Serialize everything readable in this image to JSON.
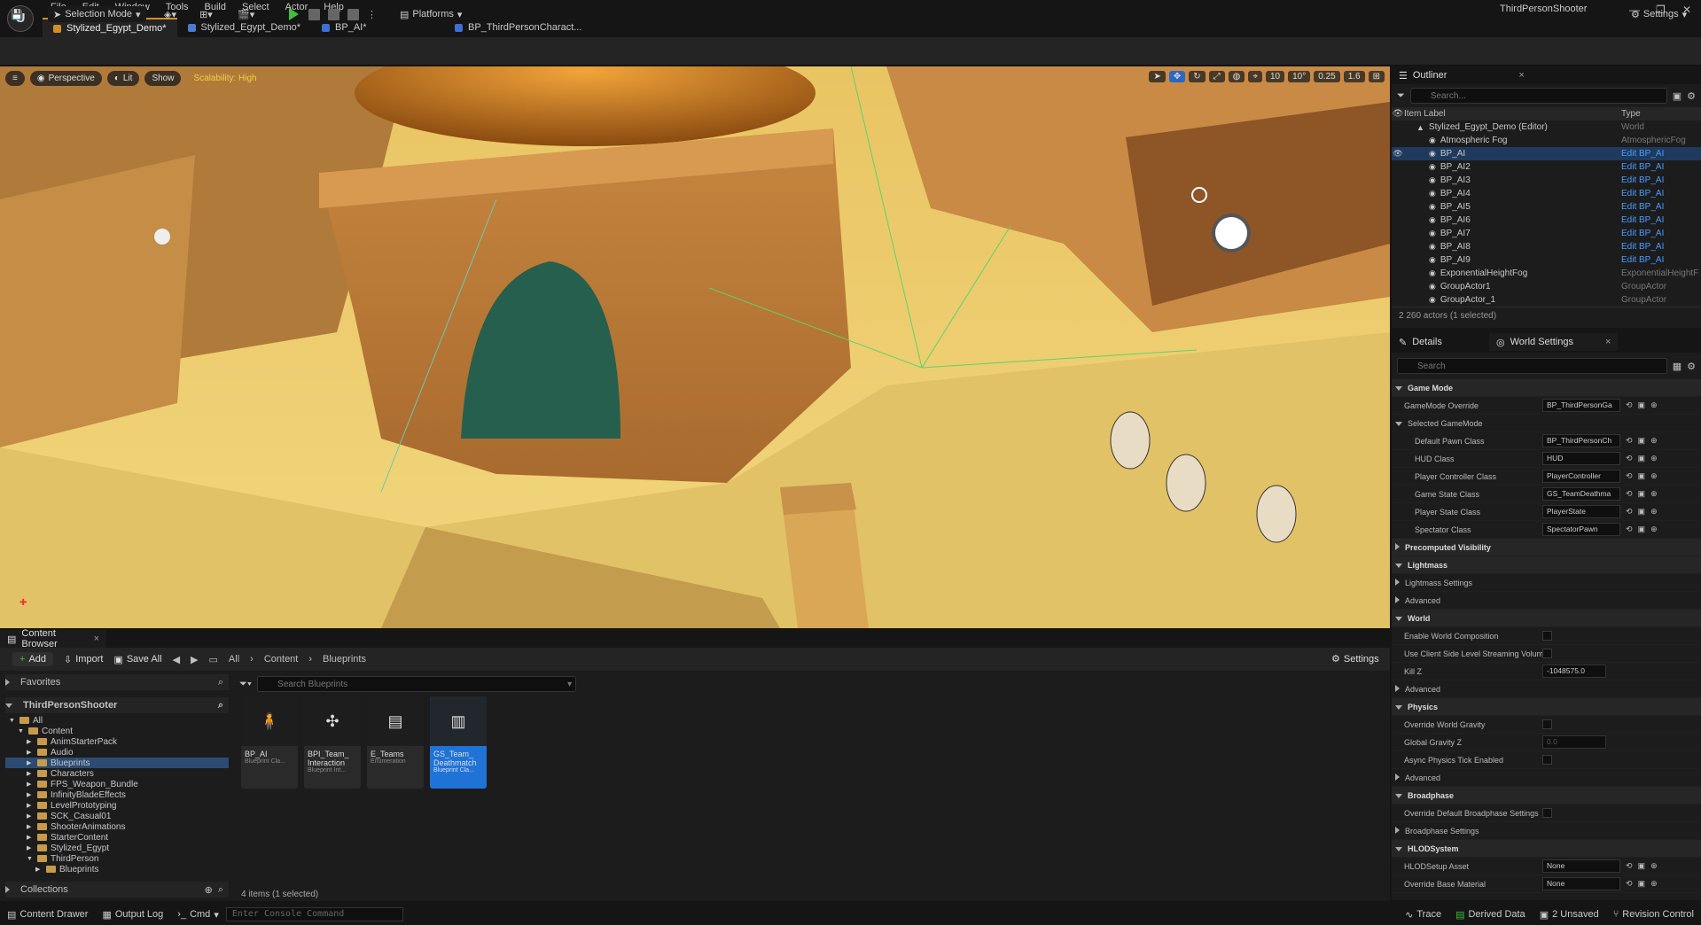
{
  "app": {
    "logo": "U",
    "menu": [
      "File",
      "Edit",
      "Window",
      "Tools",
      "Build",
      "Select",
      "Actor",
      "Help"
    ],
    "project_name": "ThirdPersonShooter",
    "tabs": [
      {
        "label": "Stylized_Egypt_Demo*",
        "icon": "level-icon",
        "active": true
      },
      {
        "label": "Stylized_Egypt_Demo*",
        "icon": "level-icon",
        "active": false
      },
      {
        "label": "BP_AI*",
        "icon": "blueprint-icon",
        "active": false
      },
      {
        "label": "BP_ThirdPersonCharact...",
        "icon": "blueprint-icon",
        "active": false
      }
    ]
  },
  "toolbar": {
    "selection_mode": "Selection Mode",
    "platforms": "Platforms",
    "settings": "Settings"
  },
  "viewport": {
    "perspective": "Perspective",
    "lit": "Lit",
    "show": "Show",
    "scalability": "Scalability: High",
    "grid_snap": "10",
    "rotation_snap": "10°",
    "scale_snap": "0.25",
    "camera_speed": "1.6"
  },
  "outliner": {
    "title": "Outliner",
    "search_placeholder": "Search...",
    "col_label": "Item Label",
    "col_type": "Type",
    "rows": [
      {
        "label": "Stylized_Egypt_Demo (Editor)",
        "type": "World",
        "indent": 1,
        "selected": false,
        "link": false
      },
      {
        "label": "Atmospheric Fog",
        "type": "AtmosphericFog",
        "indent": 2,
        "selected": false,
        "link": false
      },
      {
        "label": "BP_AI",
        "type": "Edit BP_AI",
        "indent": 2,
        "selected": true,
        "link": true
      },
      {
        "label": "BP_AI2",
        "type": "Edit BP_AI",
        "indent": 2,
        "selected": false,
        "link": true
      },
      {
        "label": "BP_AI3",
        "type": "Edit BP_AI",
        "indent": 2,
        "selected": false,
        "link": true
      },
      {
        "label": "BP_AI4",
        "type": "Edit BP_AI",
        "indent": 2,
        "selected": false,
        "link": true
      },
      {
        "label": "BP_AI5",
        "type": "Edit BP_AI",
        "indent": 2,
        "selected": false,
        "link": true
      },
      {
        "label": "BP_AI6",
        "type": "Edit BP_AI",
        "indent": 2,
        "selected": false,
        "link": true
      },
      {
        "label": "BP_AI7",
        "type": "Edit BP_AI",
        "indent": 2,
        "selected": false,
        "link": true
      },
      {
        "label": "BP_AI8",
        "type": "Edit BP_AI",
        "indent": 2,
        "selected": false,
        "link": true
      },
      {
        "label": "BP_AI9",
        "type": "Edit BP_AI",
        "indent": 2,
        "selected": false,
        "link": true
      },
      {
        "label": "ExponentialHeightFog",
        "type": "ExponentialHeightF",
        "indent": 2,
        "selected": false,
        "link": false
      },
      {
        "label": "GroupActor1",
        "type": "GroupActor",
        "indent": 2,
        "selected": false,
        "link": false
      },
      {
        "label": "GroupActor_1",
        "type": "GroupActor",
        "indent": 2,
        "selected": false,
        "link": false
      }
    ],
    "footer": "2 260 actors (1 selected)"
  },
  "details": {
    "tab_details": "Details",
    "tab_world_settings": "World Settings",
    "search_placeholder": "Search",
    "rows": [
      {
        "kind": "cat",
        "label": "Game Mode"
      },
      {
        "kind": "dd",
        "label": "GameMode Override",
        "value": "BP_ThirdPersonGa"
      },
      {
        "kind": "sub",
        "label": "Selected GameMode"
      },
      {
        "kind": "dd",
        "label": "Default Pawn Class",
        "value": "BP_ThirdPersonCh",
        "indent": true
      },
      {
        "kind": "dd",
        "label": "HUD Class",
        "value": "HUD",
        "indent": true
      },
      {
        "kind": "dd",
        "label": "Player Controller Class",
        "value": "PlayerController",
        "indent": true
      },
      {
        "kind": "dd",
        "label": "Game State Class",
        "value": "GS_TeamDeathma",
        "indent": true
      },
      {
        "kind": "dd",
        "label": "Player State Class",
        "value": "PlayerState",
        "indent": true
      },
      {
        "kind": "dd",
        "label": "Spectator Class",
        "value": "SpectatorPawn",
        "indent": true
      },
      {
        "kind": "catc",
        "label": "Precomputed Visibility"
      },
      {
        "kind": "cat",
        "label": "Lightmass"
      },
      {
        "kind": "subc",
        "label": "Lightmass Settings"
      },
      {
        "kind": "subc",
        "label": "Advanced"
      },
      {
        "kind": "cat",
        "label": "World"
      },
      {
        "kind": "cb",
        "label": "Enable World Composition"
      },
      {
        "kind": "cb",
        "label": "Use Client Side Level Streaming Volumes"
      },
      {
        "kind": "num",
        "label": "Kill Z",
        "value": "-1048575.0"
      },
      {
        "kind": "subc",
        "label": "Advanced"
      },
      {
        "kind": "cat",
        "label": "Physics"
      },
      {
        "kind": "cb",
        "label": "Override World Gravity"
      },
      {
        "kind": "num",
        "label": "Global Gravity Z",
        "value": "0.0",
        "dim": true
      },
      {
        "kind": "cb",
        "label": "Async Physics Tick Enabled"
      },
      {
        "kind": "subc",
        "label": "Advanced"
      },
      {
        "kind": "cat",
        "label": "Broadphase"
      },
      {
        "kind": "cb",
        "label": "Override Default Broadphase Settings"
      },
      {
        "kind": "subc",
        "label": "Broadphase Settings"
      },
      {
        "kind": "cat",
        "label": "HLODSystem"
      },
      {
        "kind": "dd",
        "label": "HLODSetup Asset",
        "value": "None"
      },
      {
        "kind": "dd",
        "label": "Override Base Material",
        "value": "None"
      }
    ]
  },
  "content_browser": {
    "tab": "Content Browser",
    "add": "Add",
    "import": "Import",
    "save_all": "Save All",
    "breadcrumb": [
      "All",
      "Content",
      "Blueprints"
    ],
    "settings": "Settings",
    "favorites": "Favorites",
    "project": "ThirdPersonShooter",
    "collections": "Collections",
    "search_placeholder": "Search Blueprints",
    "tree": [
      {
        "label": "All",
        "depth": 0,
        "open": true,
        "selected": false
      },
      {
        "label": "Content",
        "depth": 1,
        "open": true,
        "selected": false
      },
      {
        "label": "AnimStarterPack",
        "depth": 2,
        "open": false,
        "selected": false
      },
      {
        "label": "Audio",
        "depth": 2,
        "open": false,
        "selected": false
      },
      {
        "label": "Blueprints",
        "depth": 2,
        "open": false,
        "selected": true
      },
      {
        "label": "Characters",
        "depth": 2,
        "open": false,
        "selected": false
      },
      {
        "label": "FPS_Weapon_Bundle",
        "depth": 2,
        "open": false,
        "selected": false
      },
      {
        "label": "InfinityBladeEffects",
        "depth": 2,
        "open": false,
        "selected": false
      },
      {
        "label": "LevelPrototyping",
        "depth": 2,
        "open": false,
        "selected": false
      },
      {
        "label": "SCK_Casual01",
        "depth": 2,
        "open": false,
        "selected": false
      },
      {
        "label": "ShooterAnimations",
        "depth": 2,
        "open": false,
        "selected": false
      },
      {
        "label": "StarterContent",
        "depth": 2,
        "open": false,
        "selected": false
      },
      {
        "label": "Stylized_Egypt",
        "depth": 2,
        "open": false,
        "selected": false
      },
      {
        "label": "ThirdPerson",
        "depth": 2,
        "open": true,
        "selected": false
      },
      {
        "label": "Blueprints",
        "depth": 3,
        "open": false,
        "selected": false
      }
    ],
    "assets": [
      {
        "name": "BP_AI",
        "type": "Blueprint Cla...",
        "icon": "character-icon",
        "selected": false
      },
      {
        "name": "BPI_Team_ Interaction",
        "type": "Blueprint Int...",
        "icon": "interface-icon",
        "selected": false
      },
      {
        "name": "E_Teams",
        "type": "Enumeration",
        "icon": "document-icon",
        "selected": false
      },
      {
        "name": "GS_Team_ Deathmatch",
        "type": "Blueprint Cla...",
        "icon": "game-state-icon",
        "selected": true
      }
    ],
    "count": "4 items (1 selected)"
  },
  "statusbar": {
    "content_drawer": "Content Drawer",
    "output_log": "Output Log",
    "cmd": "Cmd",
    "console_placeholder": "Enter Console Command",
    "trace": "Trace",
    "derived_data": "Derived Data",
    "unsaved": "2 Unsaved",
    "revision_control": "Revision Control"
  }
}
